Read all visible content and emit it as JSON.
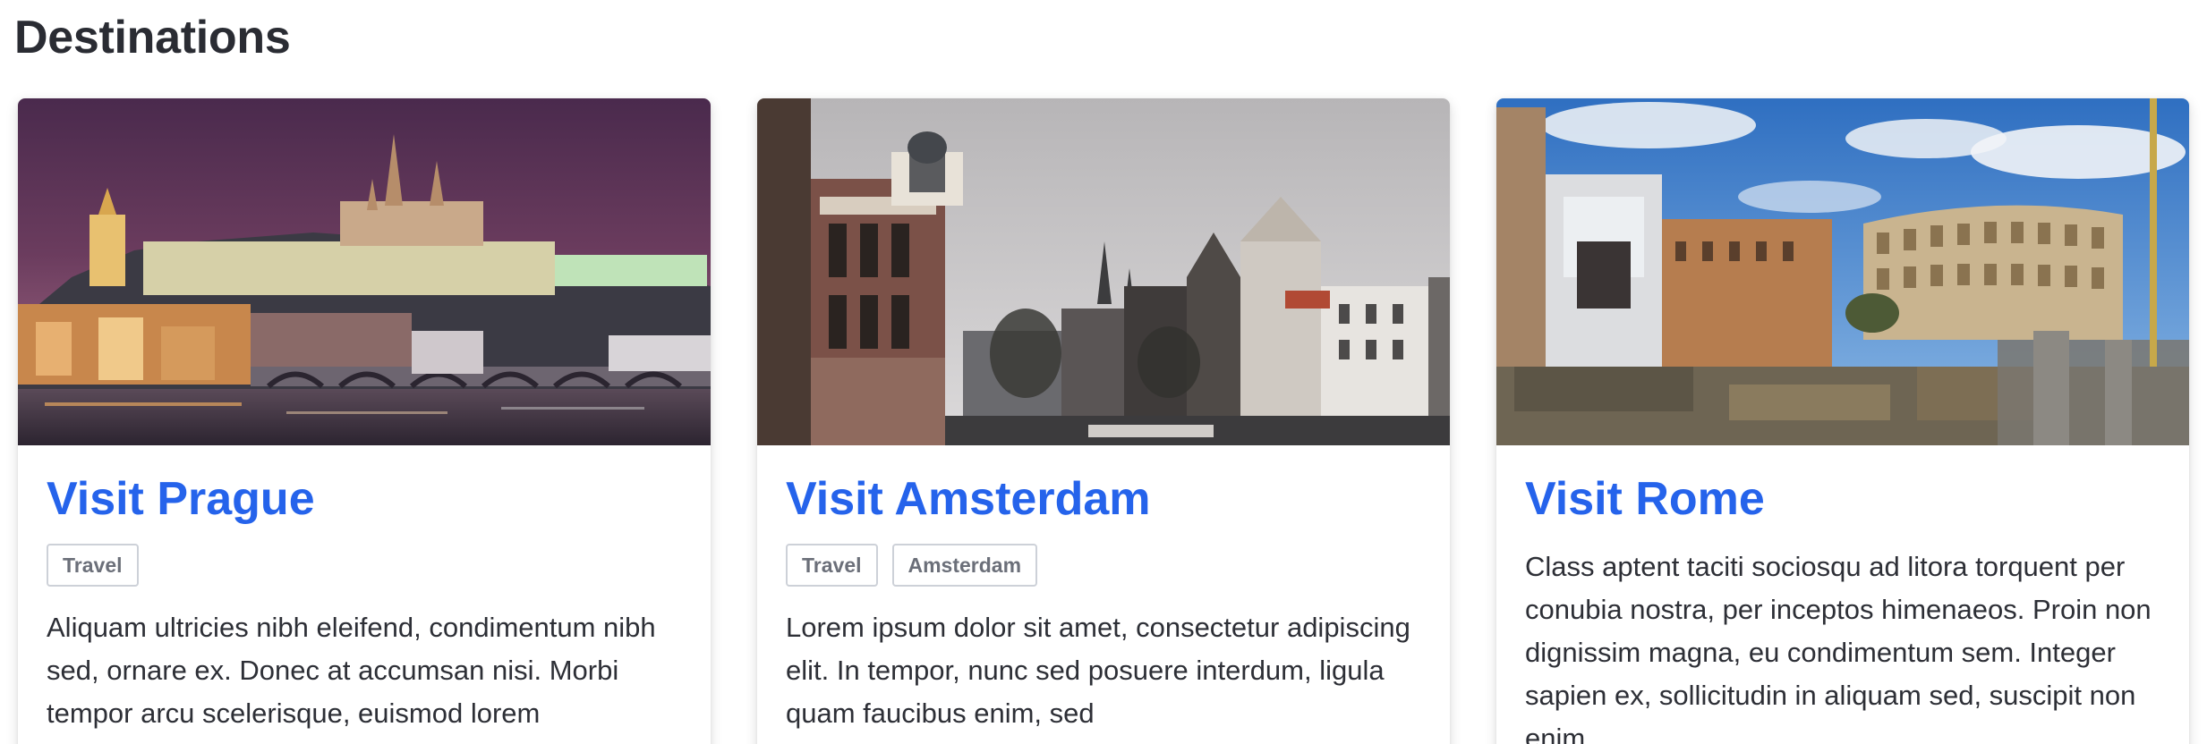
{
  "page": {
    "heading": "Destinations"
  },
  "cards": [
    {
      "image_alt": "Prague castle at night",
      "title": "Visit Prague",
      "tags": [
        "Travel"
      ],
      "description": "Aliquam ultricies nibh eleifend, condimentum nibh sed, ornare ex. Donec at accumsan nisi. Morbi tempor arcu scelerisque, euismod lorem"
    },
    {
      "image_alt": "Amsterdam canal houses",
      "title": "Visit Amsterdam",
      "tags": [
        "Travel",
        "Amsterdam"
      ],
      "description": "Lorem ipsum dolor sit amet, consectetur adipiscing elit. In tempor, nunc sed posuere interdum, ligula quam faucibus enim, sed"
    },
    {
      "image_alt": "Rome Colosseum",
      "title": "Visit Rome",
      "tags": [],
      "description": "Class aptent taciti sociosqu ad litora torquent per conubia nostra, per inceptos himenaeos. Proin non dignissim magna, eu condimentum sem. Integer sapien ex, sollicitudin in aliquam sed, suscipit non enim."
    }
  ],
  "colors": {
    "title_link": "#2563eb",
    "heading": "#2a2c33",
    "tag_border": "#cdd1d8",
    "tag_text": "#6b6f79"
  }
}
